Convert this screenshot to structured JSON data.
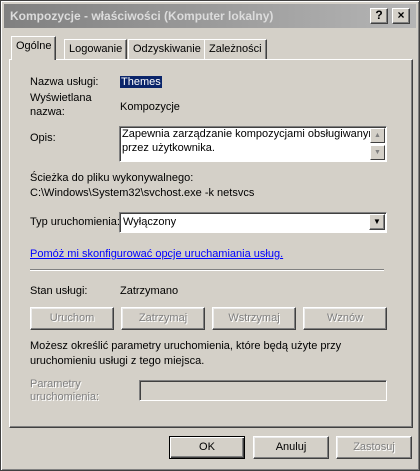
{
  "window": {
    "title": "Kompozycje - właściwości (Komputer lokalny)",
    "help_glyph": "?",
    "close_glyph": "×"
  },
  "tabs": [
    {
      "label": "Ogólne"
    },
    {
      "label": "Logowanie"
    },
    {
      "label": "Odzyskiwanie"
    },
    {
      "label": "Zależności"
    }
  ],
  "general": {
    "service_name_label": "Nazwa usługi:",
    "service_name_value": "Themes",
    "display_name_label_1": "Wyświetlana",
    "display_name_label_2": "nazwa:",
    "display_name_value": "Kompozycje",
    "description_label": "Opis:",
    "description_line_1": "Zapewnia zarządzanie kompozycjami obsługiwanymi",
    "description_line_2": "przez użytkownika.",
    "path_label": "Ścieżka do pliku wykonywalnego:",
    "path_value": "C:\\Windows\\System32\\svchost.exe -k netsvcs",
    "startup_type_label": "Typ uruchomienia:",
    "startup_type_value": "Wyłączony",
    "help_link": "Pomóż mi skonfigurować opcje uruchamiania usług.",
    "status_label": "Stan usługi:",
    "status_value": "Zatrzymano",
    "start_button": "Uruchom",
    "stop_button": "Zatrzymaj",
    "pause_button": "Wstrzymaj",
    "resume_button": "Wznów",
    "params_info_1": "Możesz określić parametry uruchomienia, które będą użyte przy",
    "params_info_2": "uruchomieniu usługi z tego miejsca.",
    "params_label_1": "Parametry",
    "params_label_2": "uruchomienia:",
    "params_value": ""
  },
  "footer": {
    "ok": "OK",
    "cancel": "Anuluj",
    "apply": "Zastosuj"
  }
}
